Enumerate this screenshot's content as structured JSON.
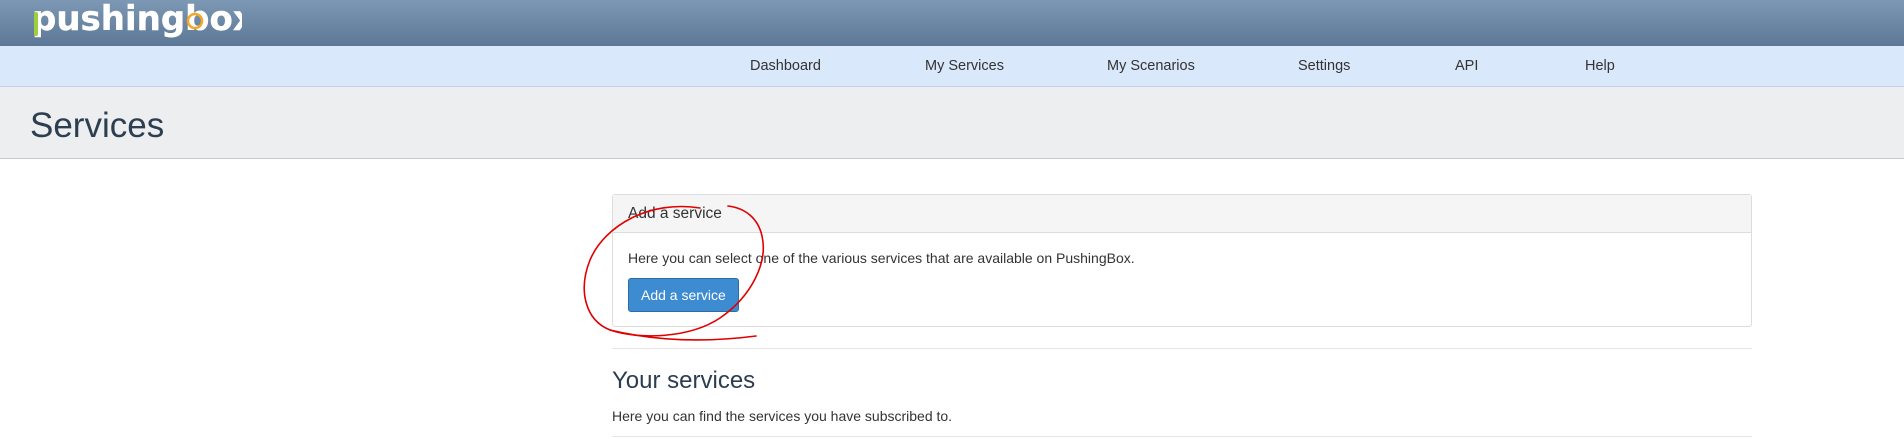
{
  "brand": {
    "logo_text": "pushingbox",
    "logo_colors": {
      "main": "#ffffff",
      "accent_green": "#9ccf3b",
      "accent_orange": "#f5a623"
    }
  },
  "nav": {
    "items": [
      {
        "label": "Dashboard"
      },
      {
        "label": "My Services"
      },
      {
        "label": "My Scenarios"
      },
      {
        "label": "Settings"
      },
      {
        "label": "API"
      },
      {
        "label": "Help"
      }
    ]
  },
  "page": {
    "title": "Services"
  },
  "add_panel": {
    "heading": "Add a service",
    "description": "Here you can select one of the various services that are available on PushingBox.",
    "button_label": "Add a service"
  },
  "your_services": {
    "title": "Your services",
    "description": "Here you can find the services you have subscribed to."
  },
  "colors": {
    "brandbar": "#6a87a5",
    "navbar": "#d9e8fb",
    "header_bg": "#eceeef",
    "primary_button": "#3d8bd0",
    "annotation_red": "#e00000"
  }
}
